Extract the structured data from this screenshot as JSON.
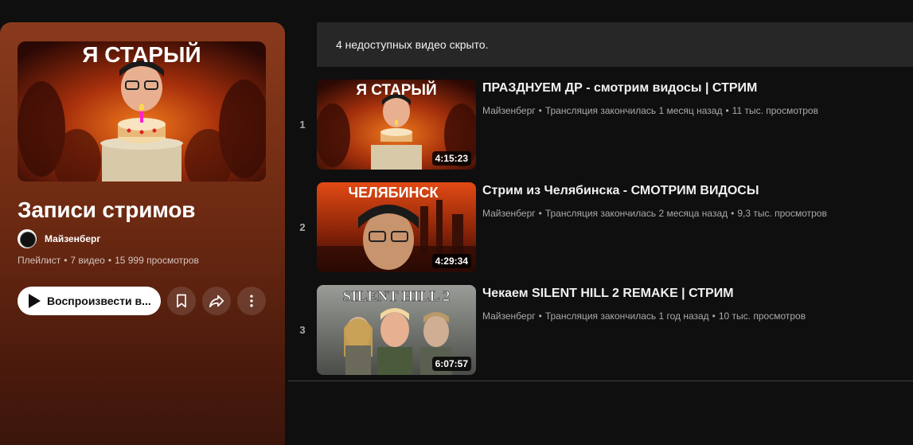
{
  "playlist": {
    "title": "Записи стримов",
    "owner": "Майзенберг",
    "type_label": "Плейлист",
    "dot": "•",
    "video_count": "7 видео",
    "views": "15 999 просмотров",
    "play_label": "Воспроизвести в...",
    "thumbnail_text": "Я СТАРЫЙ"
  },
  "notice": {
    "text": "4 недоступных видео скрыто."
  },
  "videos": [
    {
      "index": "1",
      "title": "ПРАЗДНУЕМ ДР - смотрим видосы | СТРИМ",
      "channel": "Майзенберг",
      "sep": "•",
      "status": "Трансляция закончилась 1 месяц назад",
      "views": "11 тыс. просмотров",
      "duration": "4:15:23",
      "thumb_text": "Я СТАРЫЙ"
    },
    {
      "index": "2",
      "title": "Стрим из Челябинска - СМОТРИМ ВИДОСЫ",
      "channel": "Майзенберг",
      "sep": "•",
      "status": "Трансляция закончилась 2 месяца назад",
      "views": "9,3 тыс. просмотров",
      "duration": "4:29:34",
      "thumb_text": "ЧЕЛЯБИНСК"
    },
    {
      "index": "3",
      "title": "Чекаем SILENT HILL 2 REMAKE | СТРИМ",
      "channel": "Майзенберг",
      "sep": "•",
      "status": "Трансляция закончилась 1 год назад",
      "views": "10 тыс. просмотров",
      "duration": "6:07:57",
      "thumb_text": "SILENT HILL 2"
    }
  ],
  "icons": {
    "play": "play-icon",
    "save": "bookmark-icon",
    "share": "share-icon",
    "more": "more-vertical-icon",
    "avatar": "channel-avatar"
  }
}
